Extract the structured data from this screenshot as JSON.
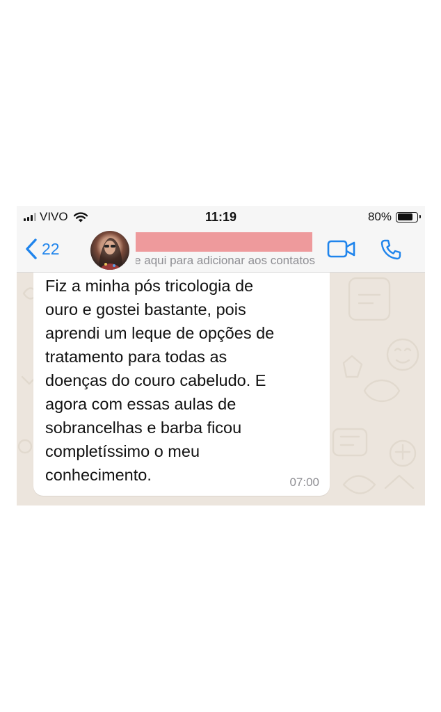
{
  "status_bar": {
    "carrier": "VIVO",
    "time": "11:19",
    "battery_percent": "80%",
    "battery_level": 0.8,
    "signal_bars_active": 3,
    "signal_bars_total": 4
  },
  "header": {
    "back_count": "22",
    "contact_hint": "Toque aqui para adicionar aos contatos",
    "name_redaction_color": "#ee9a9c",
    "icons": [
      "chevron-left-icon",
      "video-call-icon",
      "phone-icon"
    ]
  },
  "message": {
    "text": "Fiz a minha pós tricologia de\nouro e gostei bastante, pois\naprendi um leque de opções de\ntratamento para todas as\ndoenças do couro cabeludo.    E\nagora com essas aulas de\nsobrancelhas e barba ficou\ncompletíssimo o meu\nconhecimento.",
    "time": "07:00"
  },
  "colors": {
    "accent": "#1f84ec",
    "chat_background": "#ece5dd",
    "bubble": "#ffffff",
    "header_background": "#f6f6f6"
  }
}
